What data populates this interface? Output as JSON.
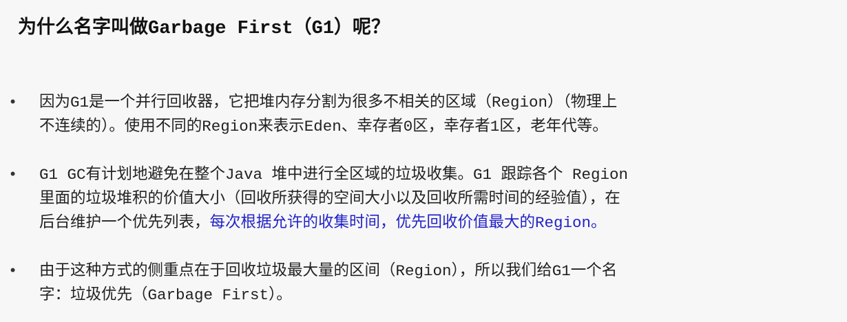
{
  "slide": {
    "title": "为什么名字叫做Garbage First（G1）呢？",
    "bullets": [
      {
        "marker": "•",
        "lines": [
          "因为G1是一个并行回收器，它把堆内存分割为很多不相关的区域（Region）（物理上",
          "不连续的）。使用不同的Region来表示Eden、幸存者0区，幸存者1区，老年代等。"
        ]
      },
      {
        "marker": "•",
        "lines": [
          "G1 GC有计划地避免在整个Java 堆中进行全区域的垃圾收集。G1 跟踪各个 Region",
          "里面的垃圾堆积的价值大小（回收所获得的空间大小以及回收所需时间的经验值），在"
        ],
        "line3_prefix": "后台维护一个优先列表，",
        "line3_highlight": "每次根据允许的收集时间，优先回收价值最大的Region。"
      },
      {
        "marker": "•",
        "lines": [
          "由于这种方式的侧重点在于回收垃圾最大量的区间（Region），所以我们给G1一个名",
          "字：垃圾优先（Garbage First）。"
        ]
      }
    ]
  },
  "colors": {
    "background": "#f7f7f7",
    "text": "#222222",
    "highlight": "#2323c8"
  }
}
